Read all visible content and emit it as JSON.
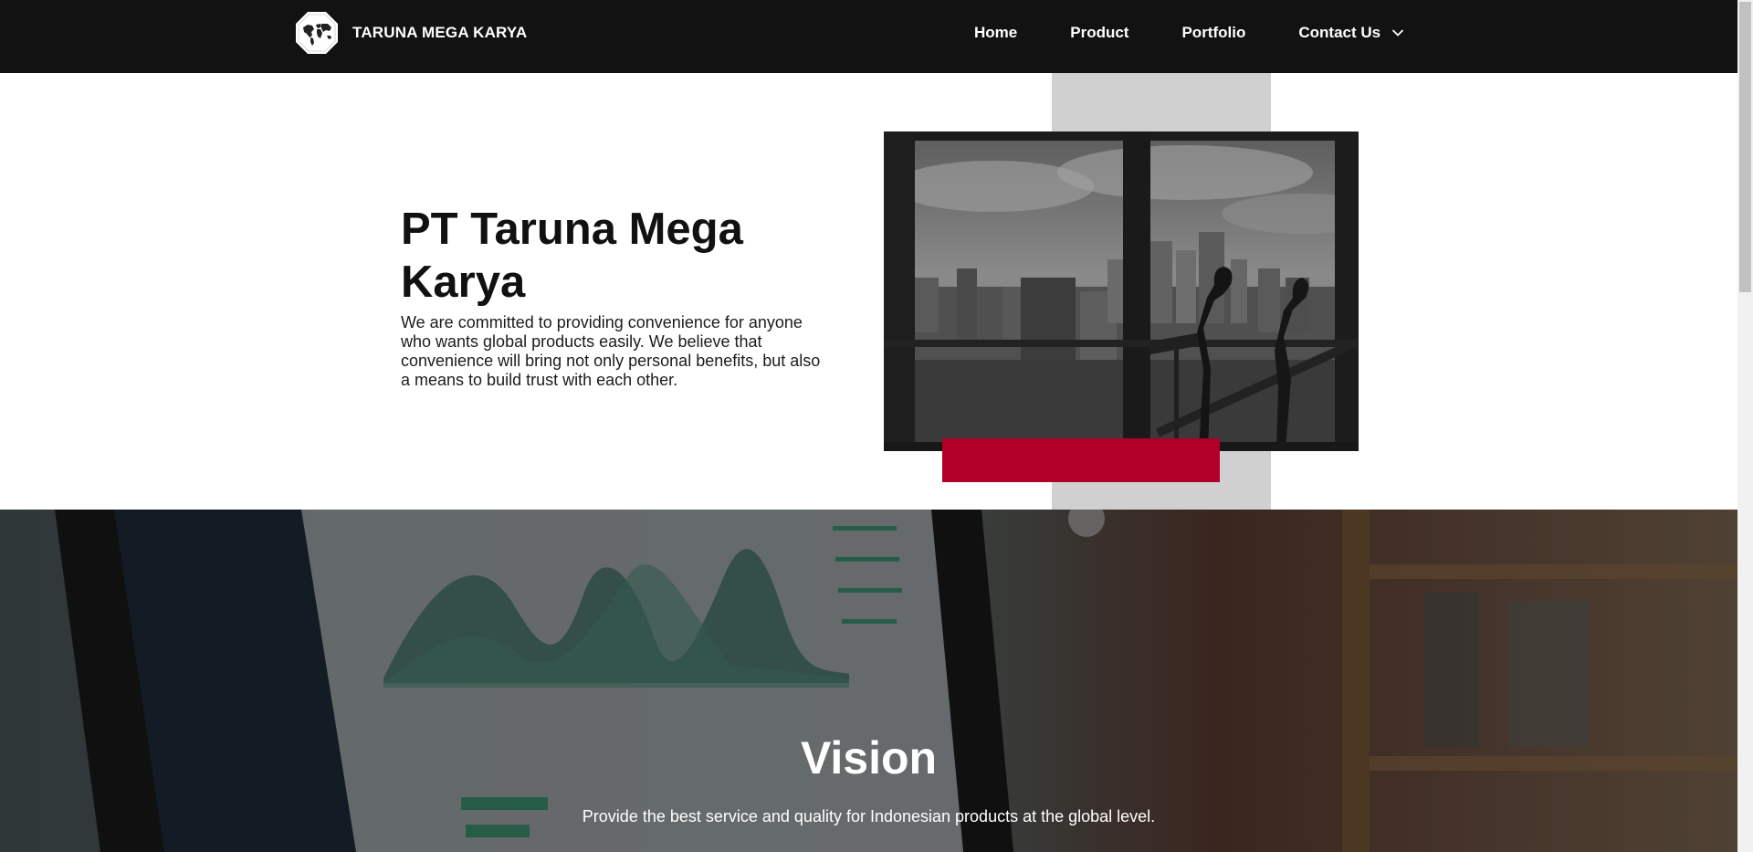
{
  "brand": {
    "name": "TARUNA MEGA KARYA",
    "logo_icon": "world-map-octagon-icon"
  },
  "nav": {
    "items": [
      "Home",
      "Product",
      "Portfolio",
      "Contact Us"
    ],
    "dropdown_icon": "chevron-down-icon"
  },
  "hero": {
    "title": "PT Taruna Mega Karya",
    "description": "We are committed to providing convenience for anyone who wants global products easily. We believe that convenience will bring not only personal benefits, but also a means to build trust with each other."
  },
  "vision": {
    "title": "Vision",
    "text": "Provide the best service and quality for Indonesian products at the global level."
  },
  "colors": {
    "navbar": "#121212",
    "accent_red": "#b0002a",
    "gray_block": "#d0d0d0"
  }
}
